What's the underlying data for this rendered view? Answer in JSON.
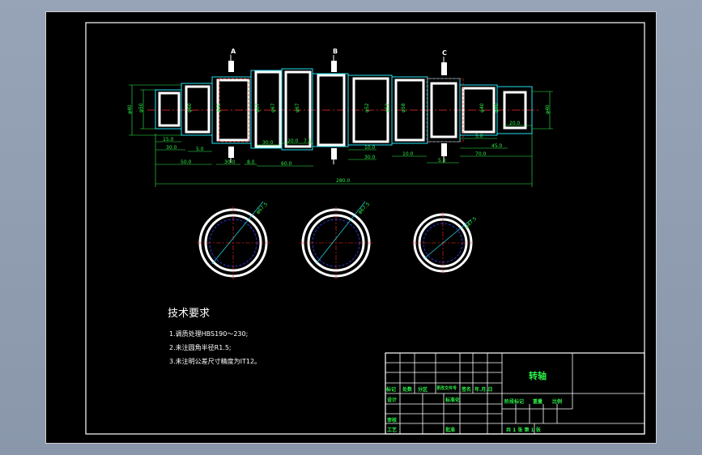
{
  "drawing": {
    "section_labels": [
      "A",
      "B",
      "C"
    ],
    "diameter_labels": [
      "φ40",
      "φ50",
      "φ60",
      "φ50",
      "φ67",
      "φ67",
      "φ67",
      "φ52",
      "φ52",
      "φ58",
      "φ40",
      "φ40",
      "φ40"
    ],
    "length_dims_top": [
      "15.0",
      "30.0",
      "5.0",
      "30.0",
      "20.0",
      "7.5",
      "10.0",
      "5.0",
      "45.0",
      "20.0"
    ],
    "length_dims_bottom": [
      "50.0",
      "30.0",
      "8.0",
      "60.0",
      "30.0",
      "10.0",
      "5.0",
      "70.0"
    ],
    "overall_length": "280.0",
    "section_radius_labels": [
      "φ67.5",
      "φ67.5",
      "φ47.5"
    ]
  },
  "notes": {
    "title": "技术要求",
    "items": [
      "1.调质处理HBS190～230;",
      "2.未注圆角半径R1.5;",
      "3.未注明公差尺寸精度为IT12。"
    ]
  },
  "title_block": {
    "part_name": "转轴",
    "row_labels": [
      "标记",
      "处数",
      "分区",
      "更改文件号",
      "签名",
      "年.月.日"
    ],
    "design_label": "设计",
    "standard_label": "标准化",
    "stage_label": "阶段标记",
    "weight_label": "重量",
    "scale_label": "比例",
    "review_label": "审核",
    "process_label": "工艺",
    "approve_label": "批准",
    "sheets_text": "共 1 张  第 1 张"
  },
  "colors": {
    "white": "#ffffff",
    "cyan": "#22dff0",
    "green": "#2ef04a",
    "red": "#ff2a2a",
    "blue": "#3340ff"
  }
}
